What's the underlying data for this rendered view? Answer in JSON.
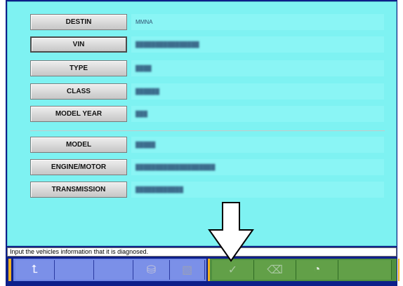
{
  "fields": [
    {
      "label": "DESTIN",
      "value": "MMNA",
      "blurred": false
    },
    {
      "label": "VIN",
      "value": "",
      "blurred": true
    },
    {
      "label": "TYPE",
      "value": "",
      "blurred": true
    },
    {
      "label": "CLASS",
      "value": "",
      "blurred": true
    },
    {
      "label": "MODEL YEAR",
      "value": "",
      "blurred": true
    },
    {
      "label": "MODEL",
      "value": "",
      "blurred": true
    },
    {
      "label": "ENGINE/MOTOR",
      "value": "",
      "blurred": true
    },
    {
      "label": "TRANSMISSION",
      "value": "",
      "blurred": true
    }
  ],
  "status_text": "Input the vehicles information that it is diagnosed.",
  "toolbar": {
    "left_buttons": [
      {
        "icon": "return-up-icon",
        "glyph": "⮤"
      },
      {
        "icon": "blank",
        "glyph": ""
      },
      {
        "icon": "blank",
        "glyph": ""
      },
      {
        "icon": "database-icon",
        "glyph": "⛁"
      },
      {
        "icon": "document-icon",
        "glyph": "▧"
      }
    ],
    "right_buttons": [
      {
        "icon": "checkmark-icon",
        "glyph": "✓"
      },
      {
        "icon": "eraser-icon",
        "glyph": "⌫"
      },
      {
        "icon": "gauge-icon",
        "glyph": "◔"
      },
      {
        "icon": "blank",
        "glyph": ""
      }
    ]
  },
  "colors": {
    "panel_bg": "#7ef2f2",
    "frame_blue": "#0d1f8a",
    "toolbar_left": "#7b90e8",
    "toolbar_right": "#62a048",
    "accent_orange": "#f0b020"
  }
}
